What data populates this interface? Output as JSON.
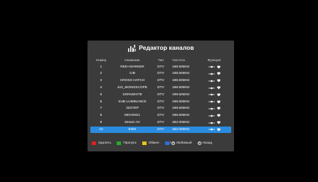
{
  "title": "Редактор каналов",
  "columns": {
    "number": "Номер",
    "name": "Название",
    "type": "Тип",
    "frequency": "Частота",
    "function": "Функция"
  },
  "rows": [
    {
      "num": "1",
      "name": "RED+MARKER",
      "type": "DTV",
      "freq": "198.50MHz"
    },
    {
      "num": "2",
      "name": "C/B",
      "type": "DTV",
      "freq": "198.50MHz"
    },
    {
      "num": "3",
      "name": "CROSS HATCH",
      "type": "DTV",
      "freq": "198.50MHz"
    },
    {
      "num": "4",
      "name": "4x3_MONOSCOPE",
      "type": "DTV",
      "freq": "198.50MHz"
    },
    {
      "num": "5",
      "name": "100%WHITE",
      "type": "DTV",
      "freq": "198.50MHz"
    },
    {
      "num": "6",
      "name": "SUB LUMINANCE",
      "type": "DTV",
      "freq": "198.50MHz"
    },
    {
      "num": "7",
      "name": "32STEP",
      "type": "DTV",
      "freq": "198.50MHz"
    },
    {
      "num": "8",
      "name": "MOVING1",
      "type": "DTV",
      "freq": "198.50MHz"
    },
    {
      "num": "9",
      "name": "stream AV",
      "type": "DTV",
      "freq": "482.00MHz"
    },
    {
      "num": "10",
      "name": "EWS",
      "type": "DTV",
      "freq": "482.00MHz"
    }
  ],
  "selected_row_index": 9,
  "row_icons": [
    "skip-icon",
    "heart-icon"
  ],
  "legend": {
    "delete": "Удалить",
    "skip": "Пропуск",
    "swap": "Обмен",
    "favorite": "Любимый",
    "back": "Назад",
    "favorite_key_symbol": "⊖",
    "back_key_symbol": "⊖"
  },
  "colors": {
    "delete": "#e02020",
    "skip": "#22b02a",
    "swap": "#e8c419",
    "favorite": "#2a6fe0",
    "selection": "#2a8ce0",
    "dialog_bg": "#3b3b3b"
  }
}
